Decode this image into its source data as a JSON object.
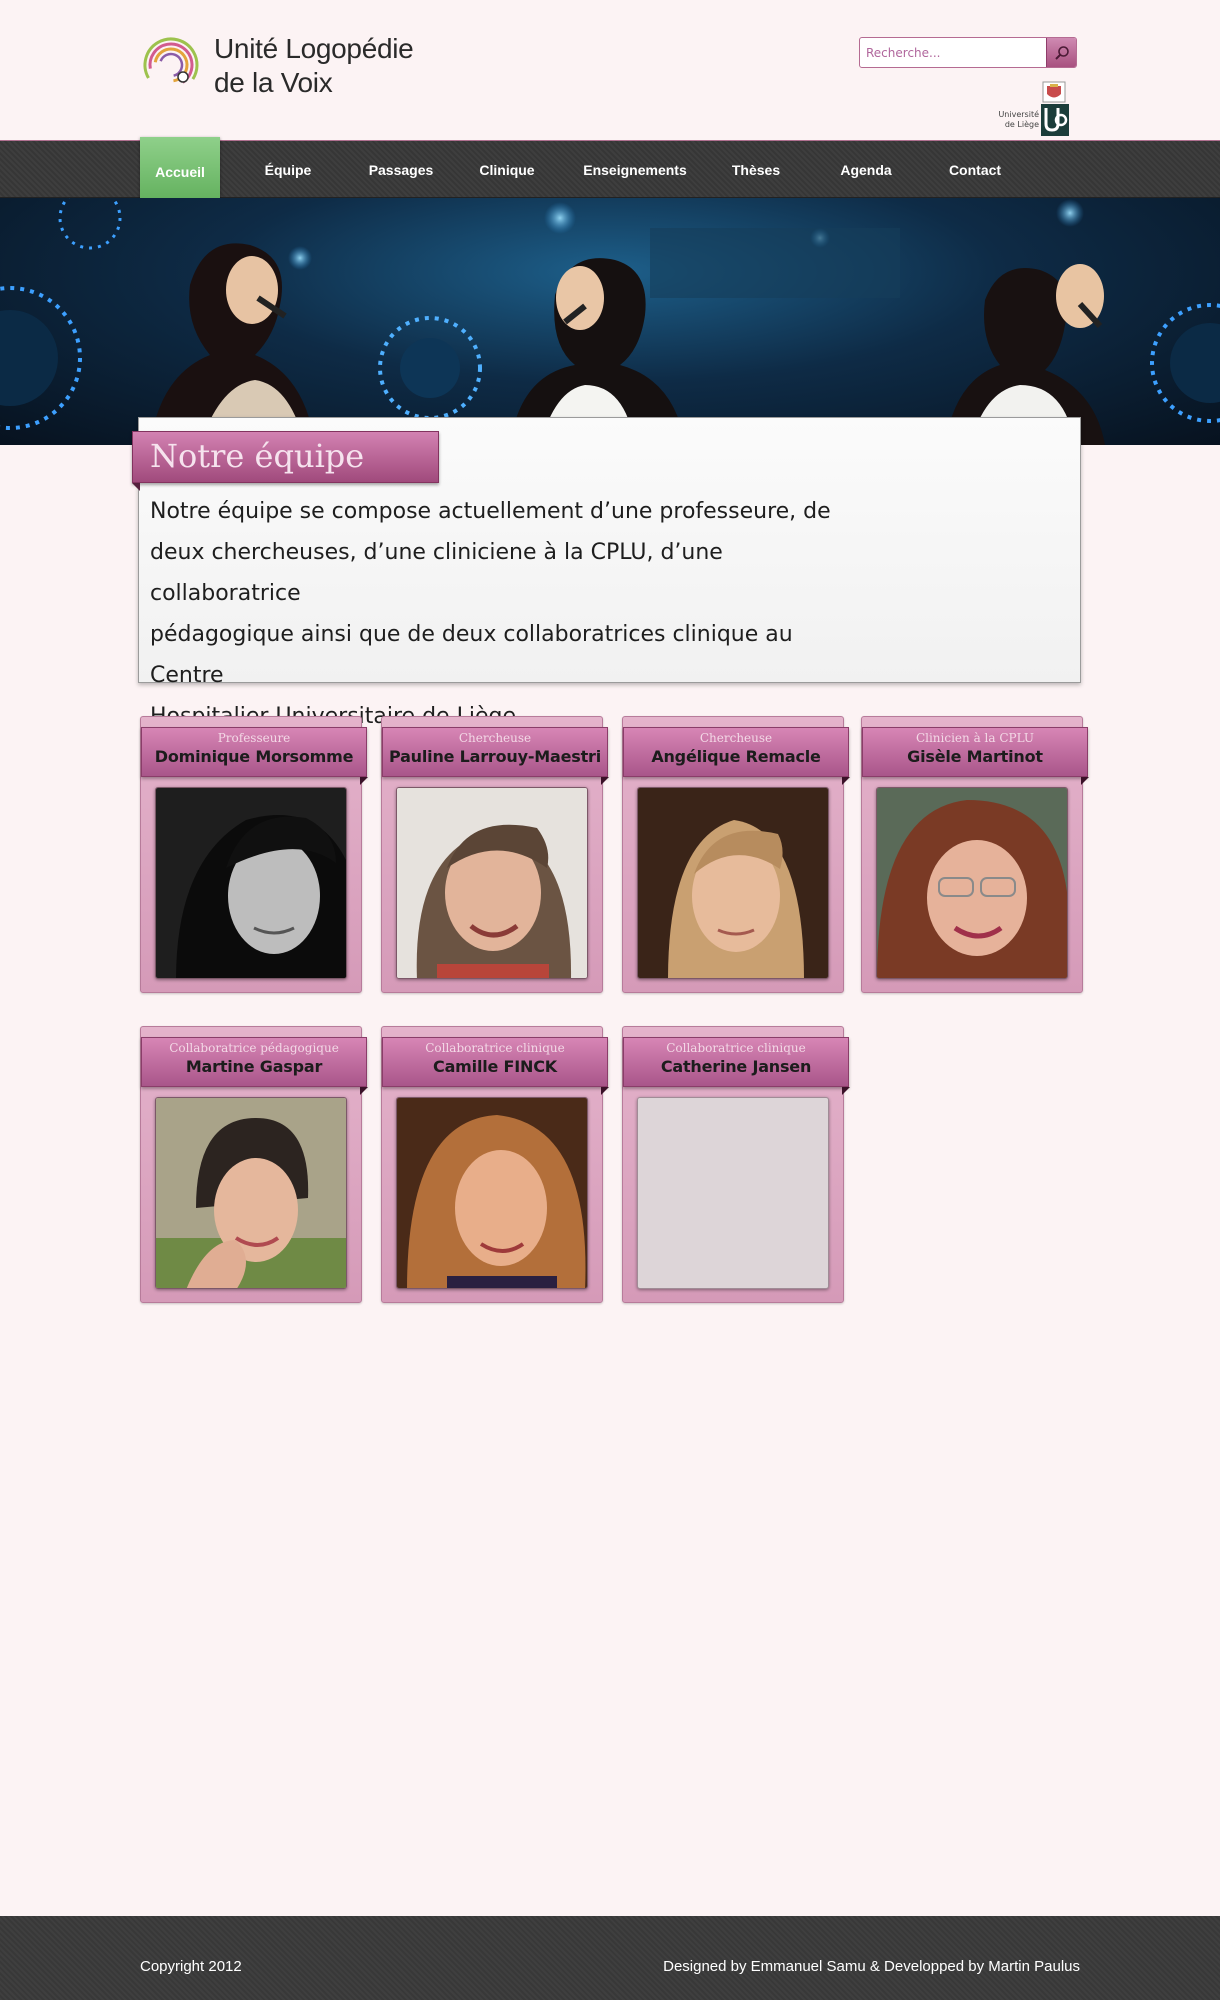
{
  "header": {
    "title_line1": "Unité Logopédie",
    "title_line2": "de la Voix",
    "search_placeholder": "Recherche...",
    "ulg_line1": "Université",
    "ulg_line2": "de Liège",
    "ulg_mark": "Ulg"
  },
  "nav": {
    "items": [
      {
        "label": "Accueil",
        "active": true
      },
      {
        "label": "Équipe"
      },
      {
        "label": "Passages"
      },
      {
        "label": "Clinique"
      },
      {
        "label": "Enseignements"
      },
      {
        "label": "Thèses"
      },
      {
        "label": "Agenda"
      },
      {
        "label": "Contact"
      }
    ]
  },
  "intro": {
    "heading": "Notre équipe",
    "lines": [
      "Notre équipe se compose actuellement d’une professeure, de",
      "deux chercheuses, d’une cliniciene à la CPLU, d’une collaboratrice",
      "pédagogique ainsi que de deux collaboratrices clinique au Centre",
      "Hospitalier Universitaire de Liège."
    ]
  },
  "team": [
    {
      "role": "Professeure",
      "name": "Dominique Morsomme"
    },
    {
      "role": "Chercheuse",
      "name": "Pauline Larrouy-Maestri"
    },
    {
      "role": "Chercheuse",
      "name": "Angélique Remacle"
    },
    {
      "role": "Clinicien à la CPLU",
      "name": "Gisèle Martinot"
    },
    {
      "role": "Collaboratrice pédagogique",
      "name": "Martine Gaspar"
    },
    {
      "role": "Collaboratrice clinique",
      "name": "Camille FINCK"
    },
    {
      "role": "Collaboratrice clinique",
      "name": "Catherine Jansen"
    }
  ],
  "footer": {
    "copyright": "Copyright 2012",
    "credits": "Designed by Emmanuel Samu & Developped by Martin Paulus"
  },
  "colors": {
    "accent_pink": "#b15a8c",
    "nav_active_green": "#6dbd68",
    "background": "#fcf3f4",
    "bar_dark": "#3b3b3b"
  }
}
